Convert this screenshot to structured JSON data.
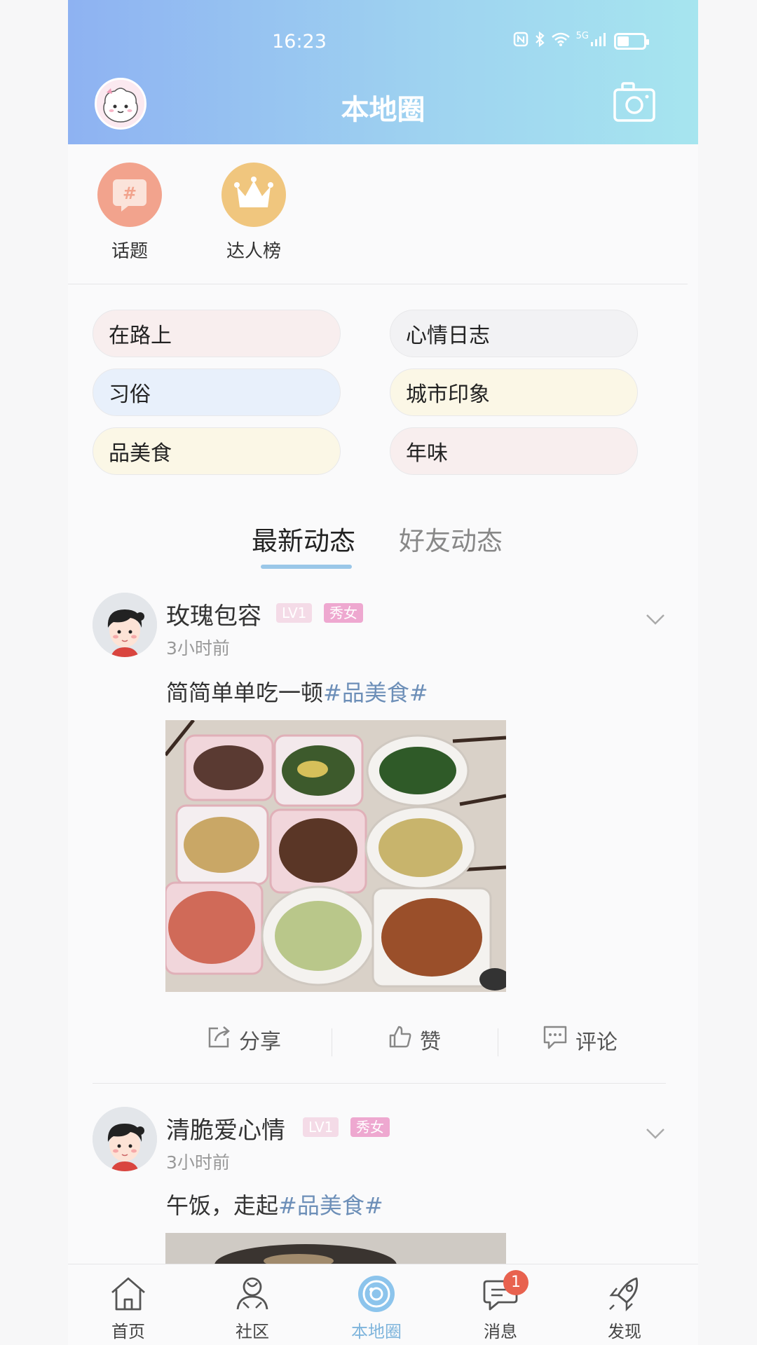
{
  "status_bar": {
    "time": "16:23",
    "network": "5G"
  },
  "header": {
    "title": "本地圈"
  },
  "shortcuts": [
    {
      "label": "话题",
      "icon": "hashtag-icon",
      "color": "#f2a38d"
    },
    {
      "label": "达人榜",
      "icon": "crown-icon",
      "color": "#f0c67e"
    }
  ],
  "topics": [
    {
      "label": "在路上",
      "color": "#f8eeee"
    },
    {
      "label": "心情日志",
      "color": "#f2f2f4"
    },
    {
      "label": "习俗",
      "color": "#e8f0fb"
    },
    {
      "label": "城市印象",
      "color": "#fbf7e6"
    },
    {
      "label": "品美食",
      "color": "#fbf7e6"
    },
    {
      "label": "年味",
      "color": "#f8eeee"
    }
  ],
  "tabs": {
    "active": "最新动态",
    "inactive": "好友动态"
  },
  "posts": [
    {
      "username": "玫瑰包容",
      "level": "LV1",
      "role": "秀女",
      "time": "3小时前",
      "text": "简简单单吃一顿",
      "hashtag": "#品美食#"
    },
    {
      "username": "清脆爱心情",
      "level": "LV1",
      "role": "秀女",
      "time": "3小时前",
      "text": "午饭，走起",
      "hashtag": "#品美食#"
    }
  ],
  "actions": {
    "share": "分享",
    "like": "赞",
    "comment": "评论"
  },
  "nav": {
    "home": "首页",
    "community": "社区",
    "local": "本地圈",
    "messages": "消息",
    "messages_badge": "1",
    "discover": "发现"
  }
}
